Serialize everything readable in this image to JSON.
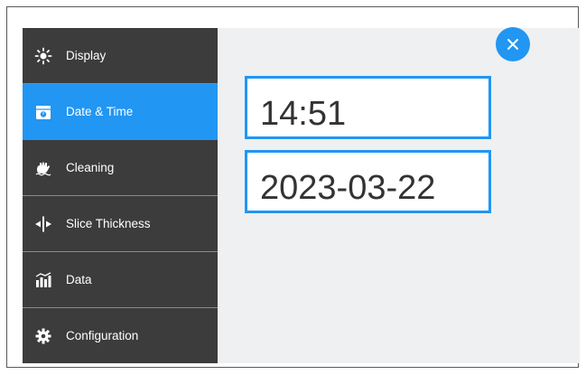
{
  "sidebar": {
    "items": [
      {
        "label": "Display",
        "icon": "sun-icon"
      },
      {
        "label": "Date & Time",
        "icon": "calendar-icon",
        "active": true
      },
      {
        "label": "Cleaning",
        "icon": "hand-wash-icon"
      },
      {
        "label": "Slice Thickness",
        "icon": "slice-thickness-icon"
      },
      {
        "label": "Data",
        "icon": "data-chart-icon"
      },
      {
        "label": "Configuration",
        "icon": "gear-icon"
      }
    ]
  },
  "main": {
    "time_value": "14:51",
    "date_value": "2023-03-22",
    "close_icon": "close-icon"
  },
  "colors": {
    "accent": "#2196f3",
    "sidebar_bg": "#3c3c3c",
    "content_bg": "#eef0f2"
  }
}
